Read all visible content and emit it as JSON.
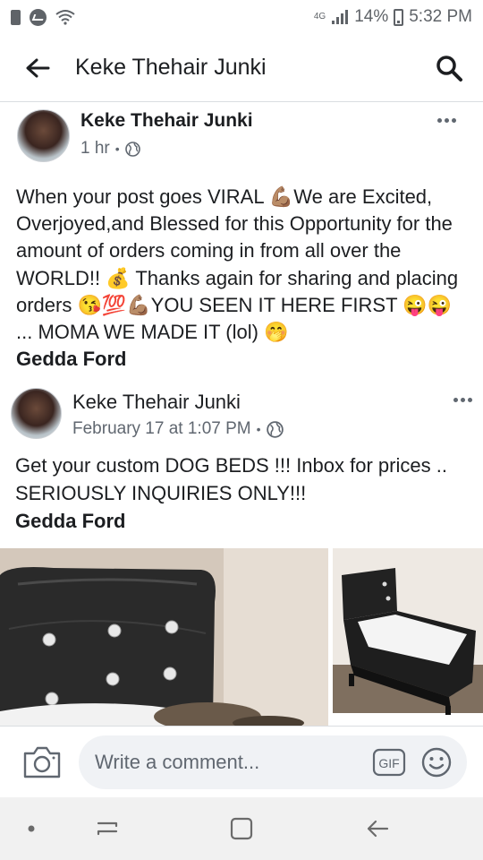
{
  "status_bar": {
    "tag": "4G",
    "battery": "14%",
    "time": "5:32 PM"
  },
  "header": {
    "title": "Keke Thehair Junki"
  },
  "post": {
    "author": "Keke Thehair Junki",
    "time": "1 hr",
    "text": "When your post goes VIRAL 💪🏽We are Excited, Overjoyed,and Blessed for this Opportunity for the amount of orders coming in from all over the WORLD!! 💰 Thanks again for sharing and placing orders 😘💯💪🏽YOU SEEN IT HERE FIRST 😜😜 ... MOMA WE MADE IT (lol) 🤭",
    "tagged": "Gedda Ford"
  },
  "shared_post": {
    "author": "Keke Thehair Junki",
    "time": "February 17 at 1:07 PM",
    "text": "Get your custom DOG BEDS !!! Inbox for prices .. SERIOUSLY INQUIRIES ONLY!!!",
    "tagged": "Gedda Ford"
  },
  "comment_bar": {
    "placeholder": "Write a comment...",
    "gif_label": "GIF"
  },
  "icons": {
    "back": "arrow-left-icon",
    "search": "search-icon",
    "globe": "globe-icon",
    "more": "more-horizontal-icon",
    "camera": "camera-icon",
    "emoji": "smiley-icon"
  },
  "colors": {
    "text": "#1c1e21",
    "secondary": "#606770",
    "input_bg": "#f0f2f5",
    "nav_bg": "#f1f1f1"
  }
}
